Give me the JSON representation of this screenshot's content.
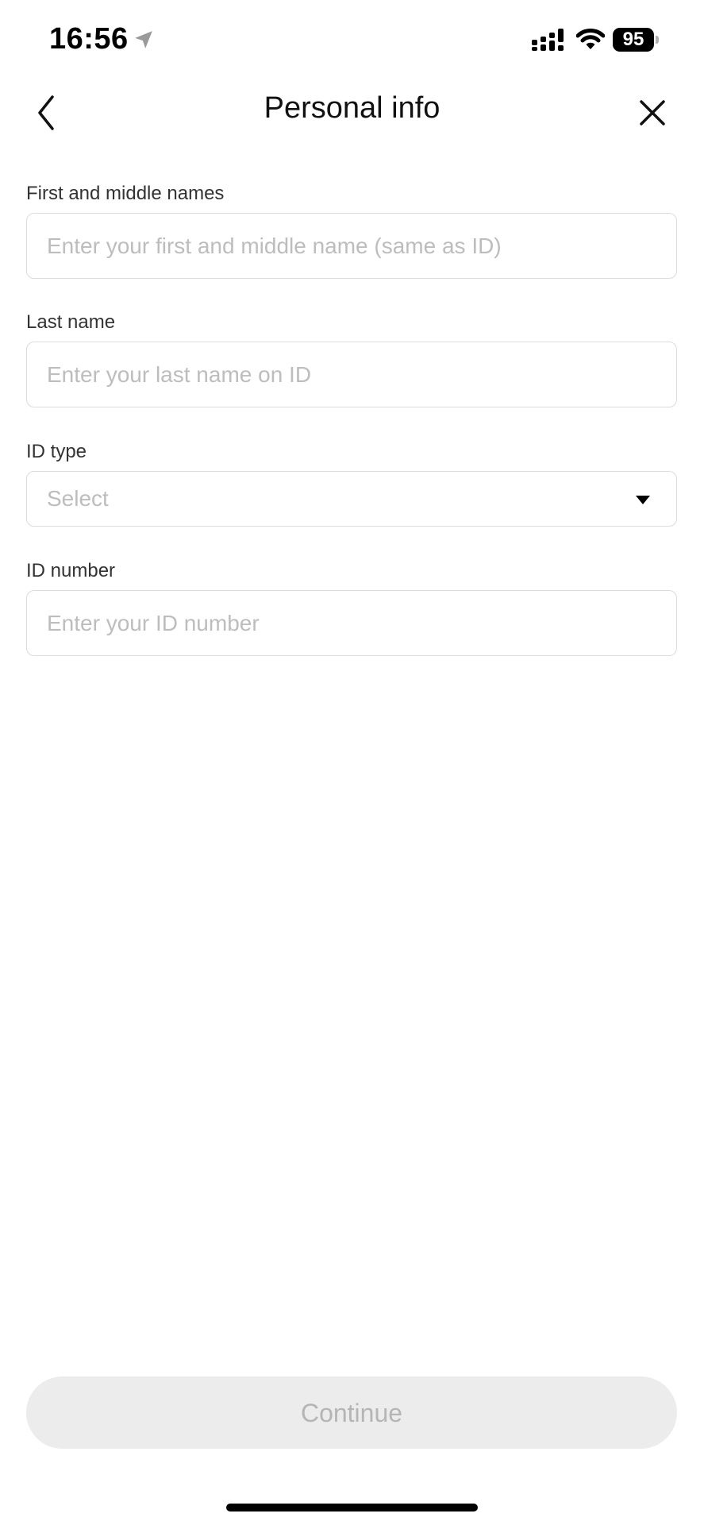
{
  "status_bar": {
    "time": "16:56",
    "battery_level": "95",
    "icons": [
      "location-arrow-icon",
      "signal-icon",
      "wifi-icon",
      "battery-icon"
    ]
  },
  "nav": {
    "title": "Personal info",
    "back_icon": "chevron-left-icon",
    "close_icon": "close-icon"
  },
  "form": {
    "first_middle_names": {
      "label": "First and middle names",
      "placeholder": "Enter your first and middle name (same as ID)",
      "value": ""
    },
    "last_name": {
      "label": "Last name",
      "placeholder": "Enter your last name on ID",
      "value": ""
    },
    "id_type": {
      "label": "ID type",
      "selected": "Select",
      "icon": "caret-down-icon"
    },
    "id_number": {
      "label": "ID number",
      "placeholder": "Enter your ID number",
      "value": ""
    }
  },
  "footer": {
    "continue_label": "Continue",
    "continue_enabled": false
  },
  "colors": {
    "background": "#ffffff",
    "placeholder_text": "#bdbdbd",
    "field_border": "#dcdcdc",
    "button_disabled_bg": "#ececec",
    "button_disabled_text": "#b5b5b5"
  }
}
